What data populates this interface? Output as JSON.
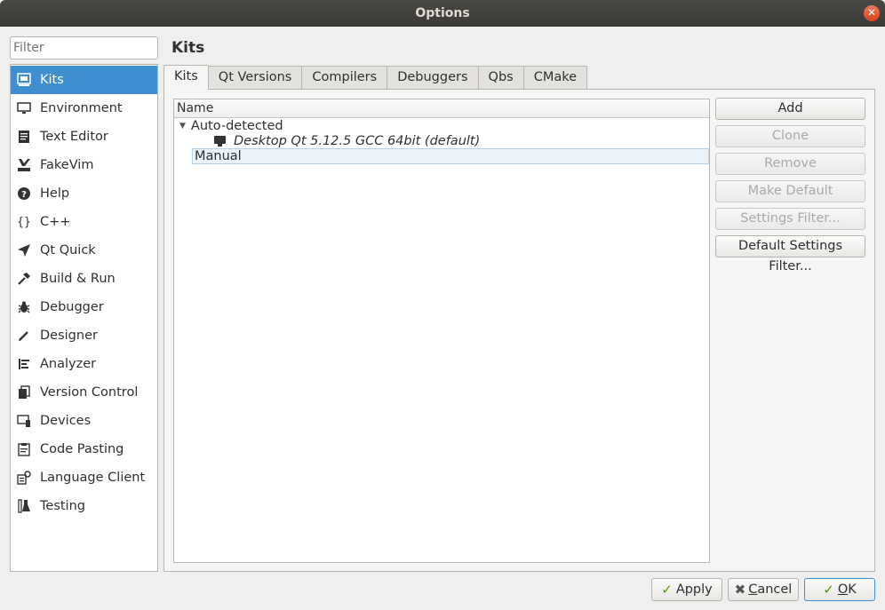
{
  "window": {
    "title": "Options"
  },
  "filter": {
    "placeholder": "Filter"
  },
  "sidebar": {
    "items": [
      {
        "label": "Kits",
        "icon": "kits-icon",
        "selected": true
      },
      {
        "label": "Environment",
        "icon": "monitor-icon"
      },
      {
        "label": "Text Editor",
        "icon": "document-icon"
      },
      {
        "label": "FakeVim",
        "icon": "fakevim-icon"
      },
      {
        "label": "Help",
        "icon": "help-icon"
      },
      {
        "label": "C++",
        "icon": "braces-icon"
      },
      {
        "label": "Qt Quick",
        "icon": "paper-plane-icon"
      },
      {
        "label": "Build & Run",
        "icon": "hammer-icon"
      },
      {
        "label": "Debugger",
        "icon": "bug-icon"
      },
      {
        "label": "Designer",
        "icon": "pencil-icon"
      },
      {
        "label": "Analyzer",
        "icon": "analyzer-icon"
      },
      {
        "label": "Version Control",
        "icon": "version-control-icon"
      },
      {
        "label": "Devices",
        "icon": "devices-icon"
      },
      {
        "label": "Code Pasting",
        "icon": "code-pasting-icon"
      },
      {
        "label": "Language Client",
        "icon": "language-client-icon"
      },
      {
        "label": "Testing",
        "icon": "flask-icon"
      }
    ]
  },
  "page": {
    "title": "Kits"
  },
  "tabs": [
    "Kits",
    "Qt Versions",
    "Compilers",
    "Debuggers",
    "Qbs",
    "CMake"
  ],
  "tree": {
    "header": "Name",
    "auto_detected": "Auto-detected",
    "kit": "Desktop Qt 5.12.5 GCC 64bit (default)",
    "manual": "Manual"
  },
  "buttons": {
    "add": "Add",
    "clone": "Clone",
    "remove": "Remove",
    "make_default": "Make Default",
    "settings_filter": "Settings Filter...",
    "default_settings_filter": "Default Settings Filter..."
  },
  "footer": {
    "apply": "Apply",
    "cancel_first": "C",
    "cancel_rest": "ancel",
    "ok_first": "O",
    "ok_rest": "K"
  }
}
